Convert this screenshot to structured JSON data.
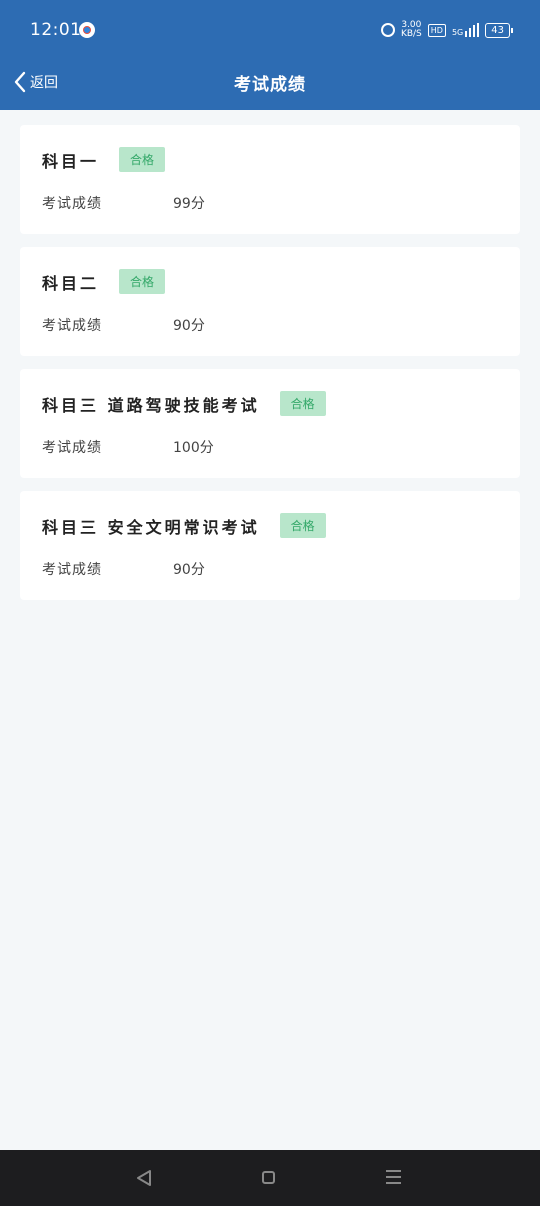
{
  "status": {
    "time": "12:01",
    "speed_value": "3.00",
    "speed_unit": "KB/S",
    "hd": "HD",
    "network": "5G",
    "battery": "43"
  },
  "header": {
    "back_label": "返回",
    "title": "考试成绩"
  },
  "results": [
    {
      "subject": "科目一",
      "badge": "合格",
      "score_label": "考试成绩",
      "score": "99分"
    },
    {
      "subject": "科目二",
      "badge": "合格",
      "score_label": "考试成绩",
      "score": "90分"
    },
    {
      "subject": "科目三 道路驾驶技能考试",
      "badge": "合格",
      "score_label": "考试成绩",
      "score": "100分"
    },
    {
      "subject": "科目三 安全文明常识考试",
      "badge": "合格",
      "score_label": "考试成绩",
      "score": "90分"
    }
  ],
  "colors": {
    "header_bg": "#2d6cb3",
    "badge_bg": "#b8e6cb",
    "badge_text": "#34a869",
    "page_bg": "#f4f7f9"
  }
}
